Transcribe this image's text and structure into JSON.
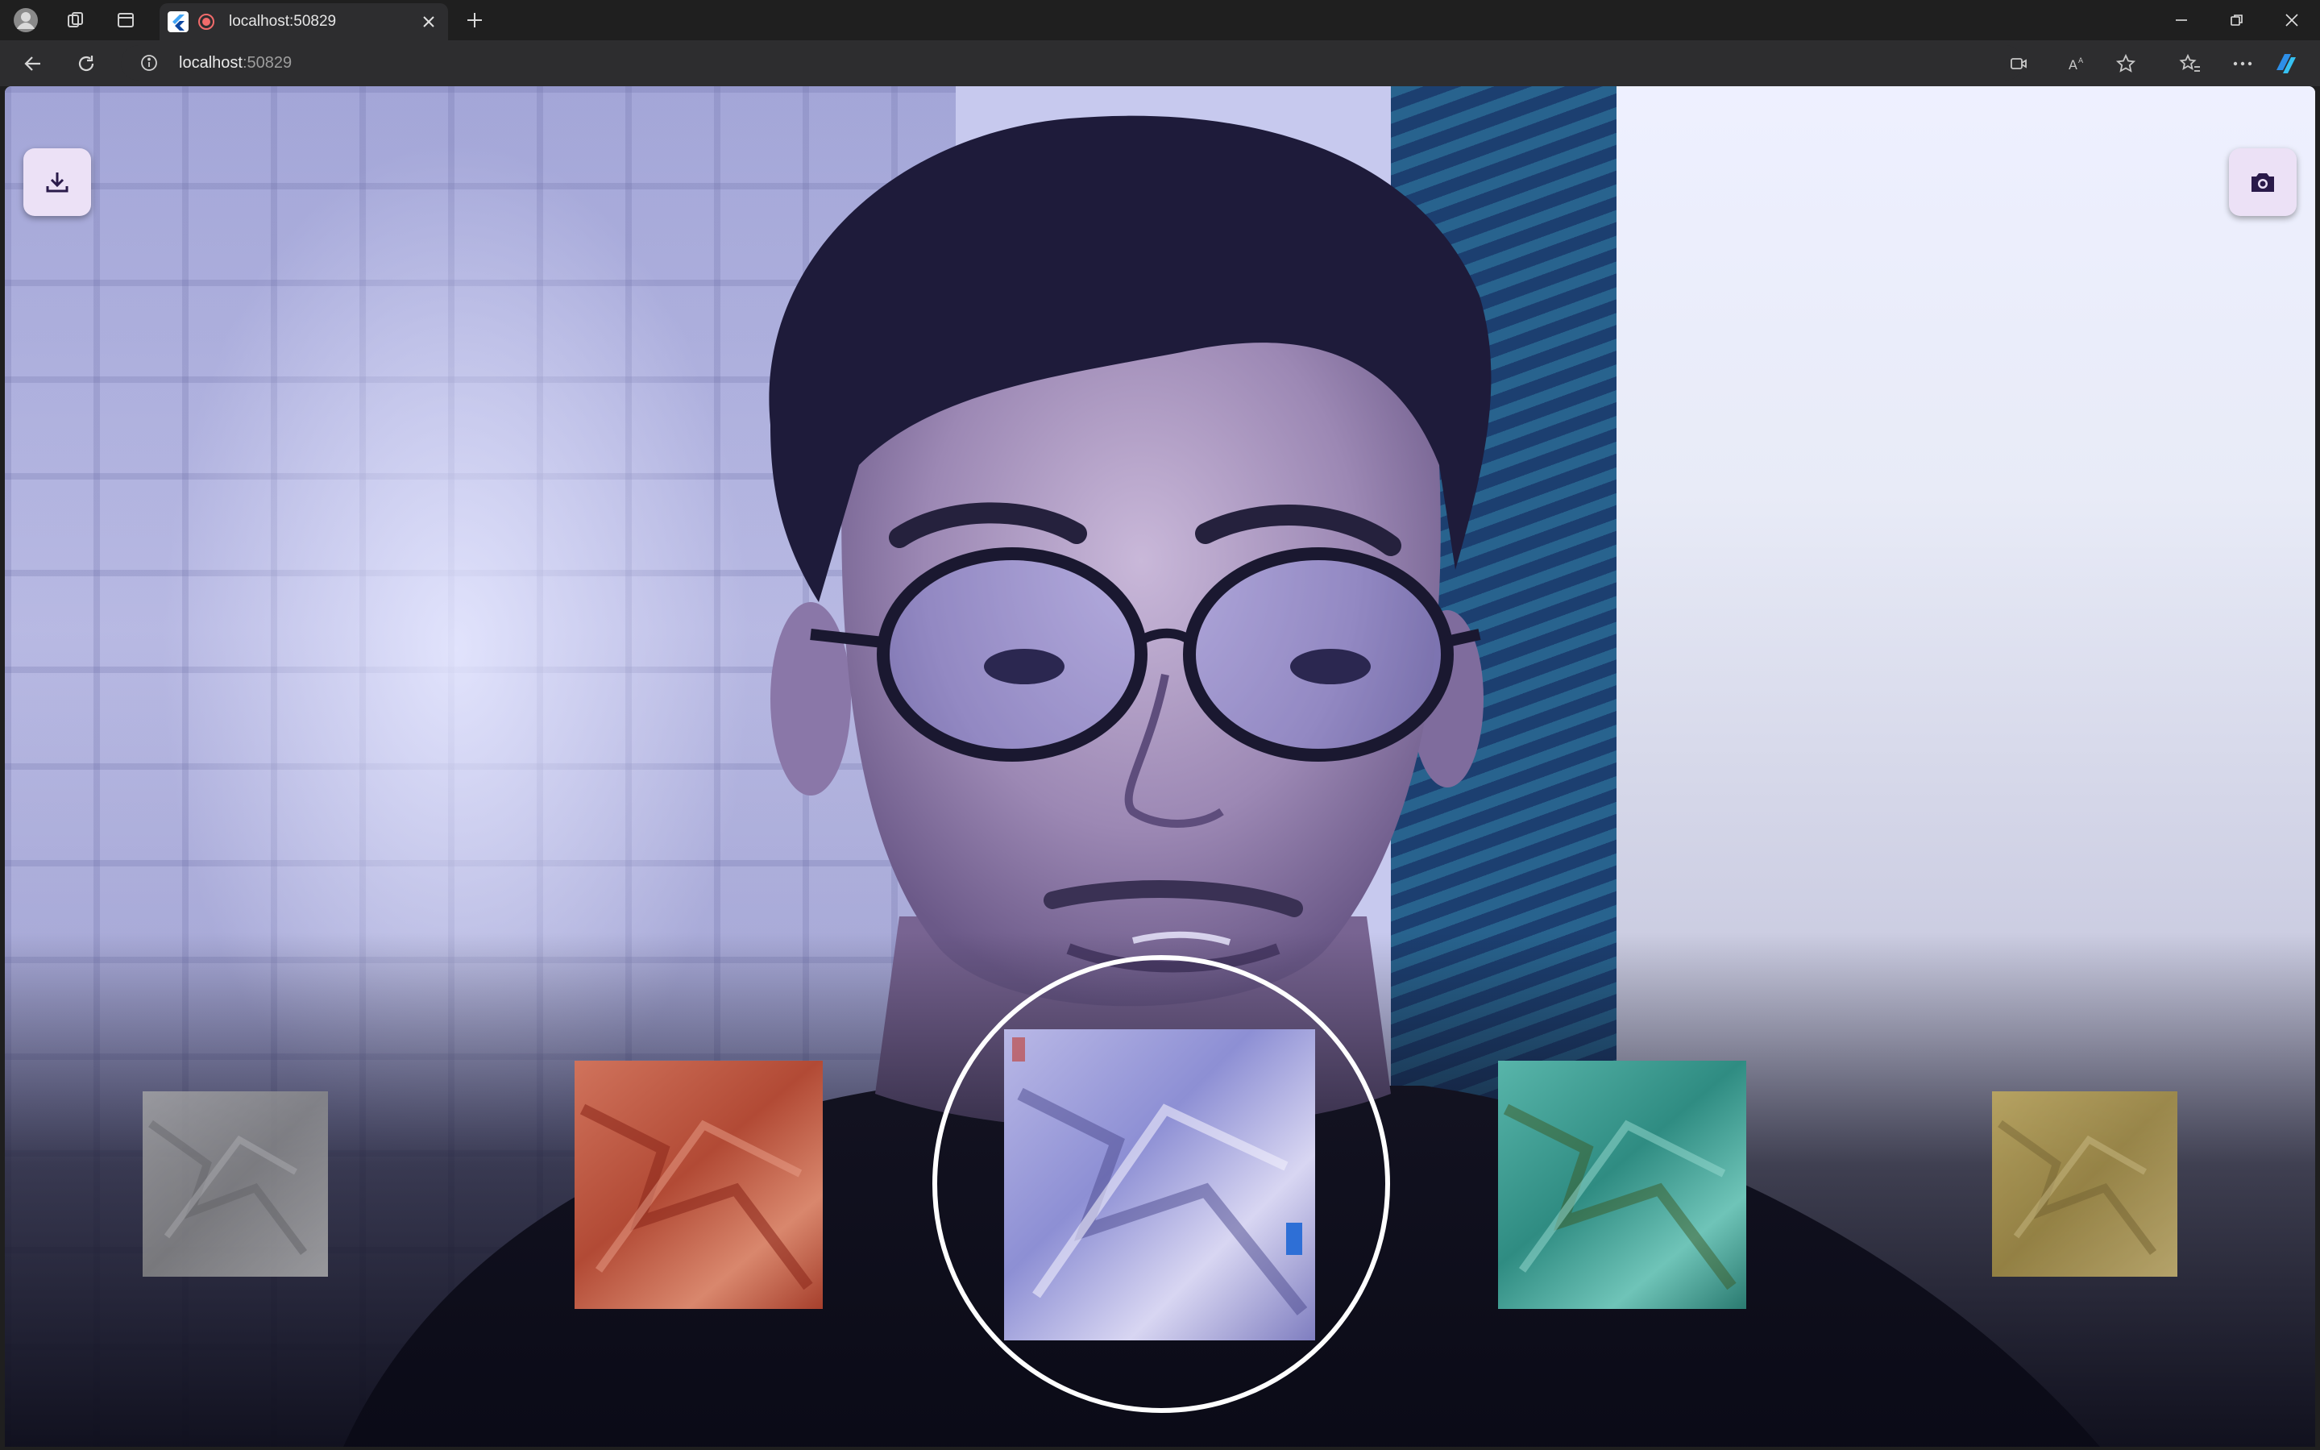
{
  "browser": {
    "tab": {
      "title": "localhost:50829",
      "close_icon": "close-icon"
    },
    "address": {
      "host": "localhost",
      "port": ":50829"
    },
    "colors": {
      "chrome_dark": "#1f1f1f",
      "toolbar": "#2d2d2f",
      "text": "#e6e6e6"
    },
    "icons": [
      "profile-icon",
      "collections-icon",
      "workspaces-icon",
      "back-icon",
      "refresh-icon",
      "site-info-icon",
      "video-icon",
      "read-aloud-icon",
      "favorite-icon",
      "favorites-icon",
      "more-icon",
      "copilot-icon"
    ]
  },
  "app": {
    "download_button_icon": "download-icon",
    "capture_button_icon": "camera-icon",
    "accent_button_bg": "#ece1f6",
    "accent_icon": "#2a1a4a",
    "filters": [
      {
        "name": "grayscale",
        "tint": "#9a9a9a",
        "selected": false
      },
      {
        "name": "red",
        "tint": "#c0533e",
        "selected": false
      },
      {
        "name": "none",
        "tint": "#8d8fd4",
        "selected": true
      },
      {
        "name": "teal",
        "tint": "#3a9e94",
        "selected": false
      },
      {
        "name": "sepia",
        "tint": "#b09a50",
        "selected": false
      }
    ]
  }
}
